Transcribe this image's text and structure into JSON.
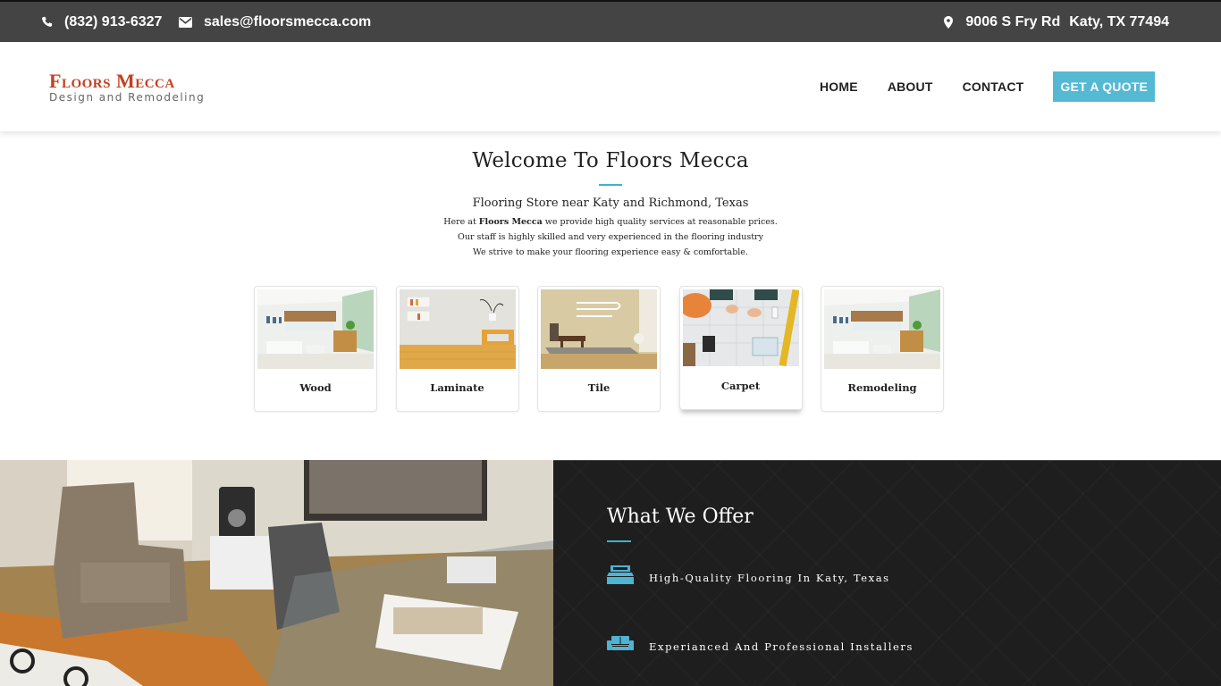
{
  "topbar": {
    "phone": "(832) 913-6327",
    "email": "sales@floorsmecca.com",
    "address_street": "9006 S Fry Rd",
    "address_city": "Katy, TX 77494",
    "icons": {
      "phone": "phone-icon",
      "email": "envelope-icon",
      "address": "map-marker-icon"
    }
  },
  "header": {
    "logo_title": "Floors Mecca",
    "logo_subtitle": "Design and Remodeling",
    "nav": [
      {
        "label": "HOME"
      },
      {
        "label": "ABOUT"
      },
      {
        "label": "CONTACT"
      }
    ],
    "cta_label": "GET A QUOTE"
  },
  "welcome": {
    "title": "Welcome To Floors Mecca",
    "subtitle": "Flooring Store near Katy and Richmond, Texas",
    "line1_prefix": "Here at ",
    "line1_bold": "Floors Mecca",
    "line1_suffix": " we provide high quality services at reasonable prices.",
    "line2": "Our staff is highly skilled and very experienced in the flooring industry",
    "line3": "We strive to make your flooring experience easy & comfortable."
  },
  "services": [
    {
      "label": "Wood",
      "image": "living-room-photo"
    },
    {
      "label": "Laminate",
      "image": "laminate-room-photo"
    },
    {
      "label": "Tile",
      "image": "tile-room-photo"
    },
    {
      "label": "Carpet",
      "image": "blueprint-planning-photo"
    },
    {
      "label": "Remodeling",
      "image": "living-room-photo"
    }
  ],
  "offer": {
    "title": "What We Offer",
    "features": [
      {
        "label": "High-Quality Flooring In Katy, Texas",
        "icon": "bed-icon"
      },
      {
        "label": "Experianced And Professional Installers",
        "icon": "sofa-icon"
      }
    ]
  },
  "colors": {
    "accent": "#55b9d3",
    "topbar_bg": "#444444",
    "logo_red": "#c4401e",
    "offer_bg": "#1e1e1e"
  }
}
